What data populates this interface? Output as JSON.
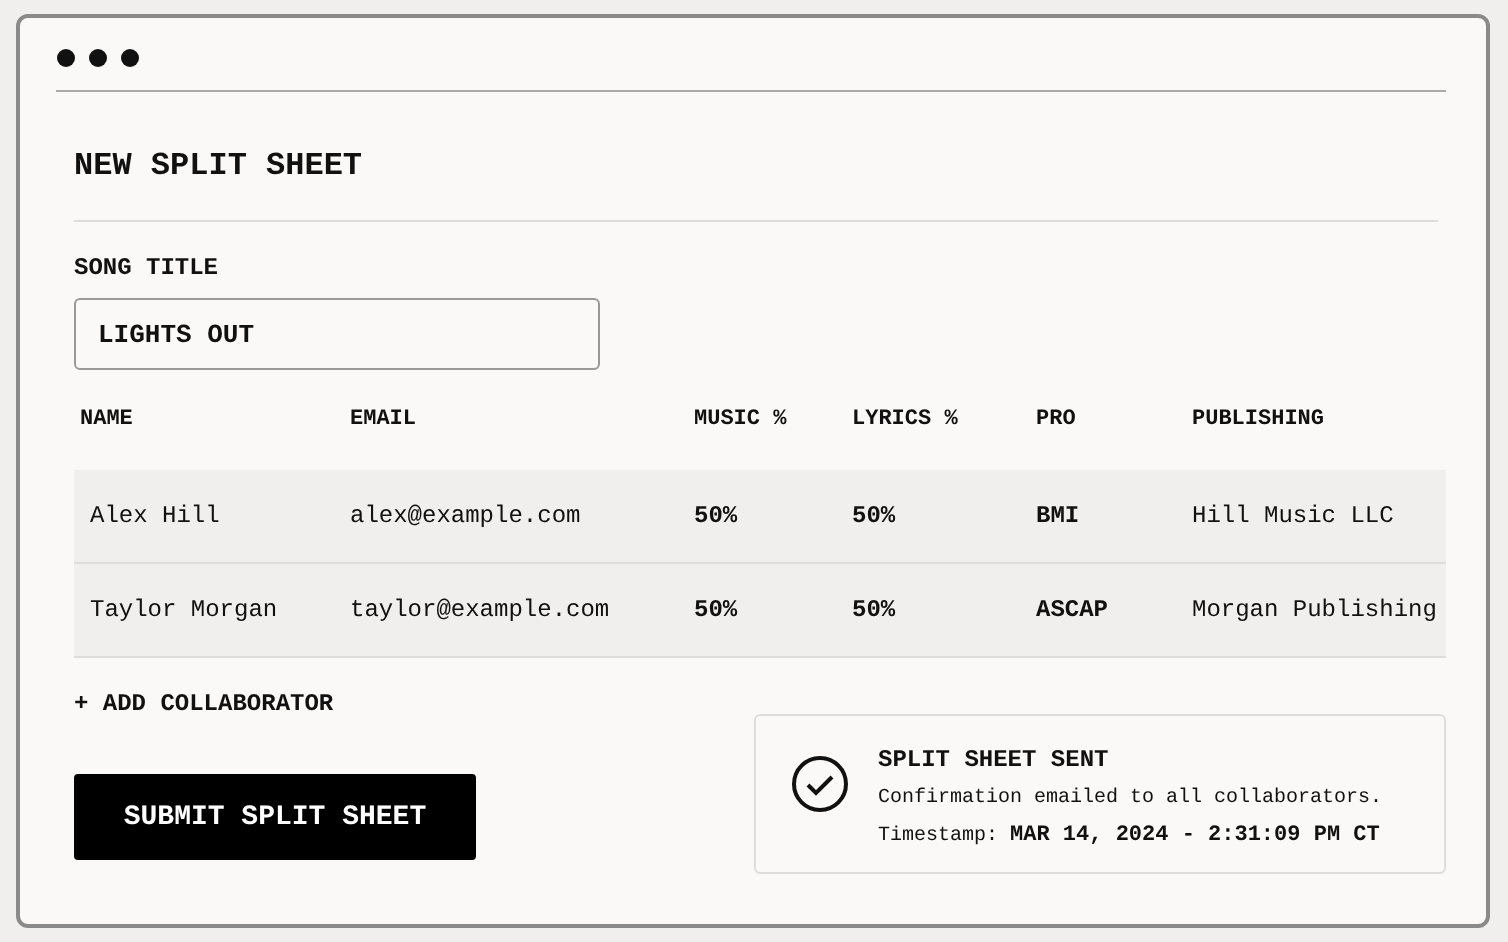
{
  "window": {
    "title": "NEW SPLIT SHEET"
  },
  "song_title": {
    "label": "SONG TITLE",
    "value": "LIGHTS OUT"
  },
  "table": {
    "columns": [
      "NAME",
      "EMAIL",
      "MUSIC %",
      "LYRICS %",
      "PRO",
      "PUBLISHING"
    ],
    "rows": [
      [
        "Alex Hill",
        "alex@example.com",
        "50%",
        "50%",
        "BMI",
        "Hill Music LLC"
      ],
      [
        "Taylor Morgan",
        "taylor@example.com",
        "50%",
        "50%",
        "ASCAP",
        "Morgan Publishing"
      ]
    ]
  },
  "add_link": "+ ADD COLLABORATOR",
  "submit_button": "SUBMIT SPLIT SHEET",
  "notice": {
    "title": "SPLIT SHEET SENT",
    "message": "Confirmation emailed to all collaborators.",
    "timestamp": "Timestamp: **MAR 14, 2024 - 2:31:09 PM CT**"
  }
}
